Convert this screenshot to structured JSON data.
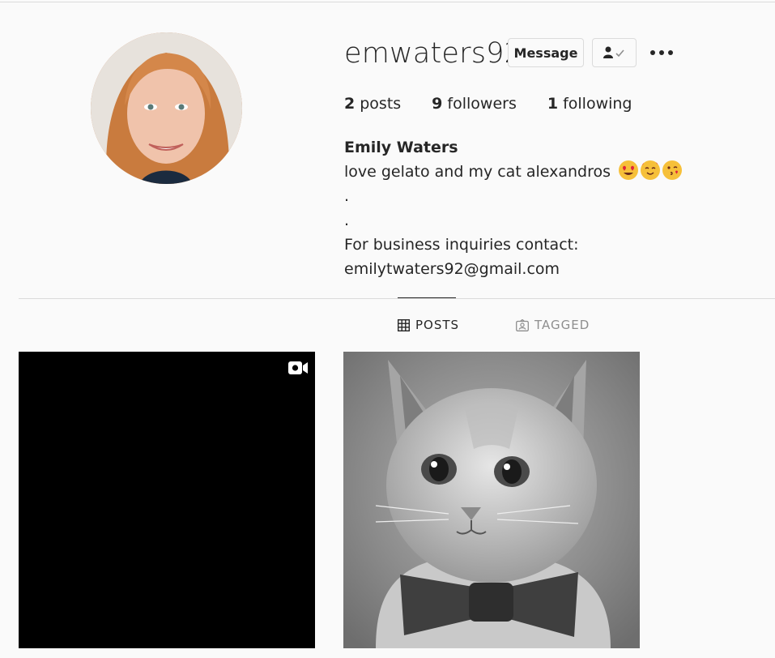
{
  "profile": {
    "username": "emwaters92",
    "message_label": "Message",
    "follow_icon": "person-check-icon",
    "more_icon": "more-horizontal-icon"
  },
  "stats": {
    "posts_count": "2",
    "posts_label": "posts",
    "followers_count": "9",
    "followers_label": "followers",
    "following_count": "1",
    "following_label": "following"
  },
  "bio": {
    "name": "Emily Waters",
    "line1": "love gelato and my cat alexandros",
    "emojis": [
      "heart-eyes-emoji",
      "smiling-hearts-emoji",
      "kissing-emoji"
    ],
    "line2": ".",
    "line3": ".",
    "line4": "For business inquiries contact: emilytwaters92@gmail.com"
  },
  "tabs": [
    {
      "label": "POSTS",
      "icon": "grid-icon",
      "active": true
    },
    {
      "label": "TAGGED",
      "icon": "tagged-icon",
      "active": false
    }
  ],
  "posts": [
    {
      "type": "video",
      "icon": "video-icon"
    },
    {
      "type": "image",
      "subject": "cat-with-bowtie-photo"
    }
  ]
}
